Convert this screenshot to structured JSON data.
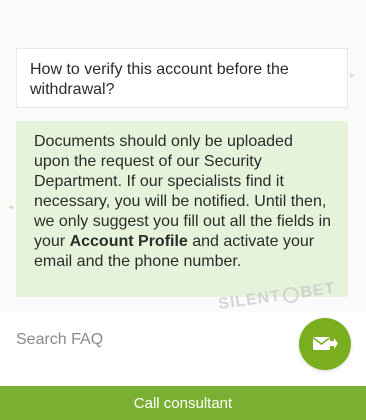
{
  "conversation": {
    "question": "How to verify this account before the withdrawal?",
    "answer_before": "Documents should only be uploaded upon the request of our Security Department. If our specialists find it necessary, you will be notified. Until then, we only suggest you fill out all the fields in your ",
    "answer_bold": "Account Profile",
    "answer_after": " and activate your email and the phone number."
  },
  "watermark": {
    "text_left": "SILENT",
    "text_right": "BET"
  },
  "search": {
    "placeholder": "Search FAQ",
    "value": ""
  },
  "actions": {
    "send_icon": "envelope-arrow-icon",
    "call_label": "Call consultant"
  },
  "colors": {
    "accent": "#7ab032",
    "answer_background": "#e6f3db"
  }
}
